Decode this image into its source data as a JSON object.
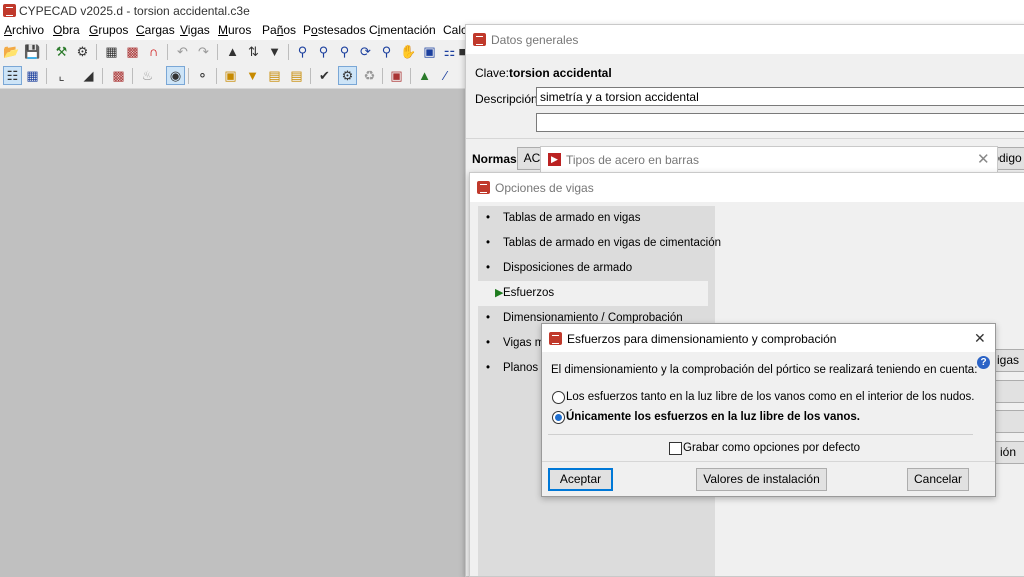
{
  "app": {
    "title": "CYPECAD v2025.d - torsion accidental.c3e"
  },
  "menu": [
    {
      "label": "Archivo",
      "u": "A"
    },
    {
      "label": "Obra",
      "u": "O"
    },
    {
      "label": "Grupos",
      "u": "G"
    },
    {
      "label": "Cargas",
      "u": "C"
    },
    {
      "label": "Vigas",
      "u": "V"
    },
    {
      "label": "Muros",
      "u": "M"
    },
    {
      "label": "Paños",
      "u": "ñ"
    },
    {
      "label": "Postesados",
      "u": "o"
    },
    {
      "label": "Cimentación",
      "u": "i"
    },
    {
      "label": "Calc",
      "u": ""
    }
  ],
  "datos_generales": {
    "title": "Datos generales",
    "clave_label": "Clave:",
    "clave_value": "torsion accidental",
    "descripcion_label": "Descripción:",
    "descripcion_value": "simetría y a torsion accidental",
    "descripcion_value2": "",
    "normas_label": "Normas:",
    "normas_btn": "AC",
    "codigo_btn": "ódigo"
  },
  "tipos_acero": {
    "title": "Tipos de acero en barras"
  },
  "opciones_vigas": {
    "title": "Opciones de vigas",
    "items": [
      {
        "label": "Tablas de armado en vigas"
      },
      {
        "label": "Tablas de armado en vigas de cimentación"
      },
      {
        "label": "Disposiciones de armado"
      },
      {
        "label": "Esfuerzos"
      },
      {
        "label": "Dimensionamiento / Comprobación"
      },
      {
        "label": "Vigas m"
      },
      {
        "label": "Planos"
      }
    ],
    "right_btn_1": "igas",
    "right_btn_4": "ión"
  },
  "esfuerzos_dialog": {
    "title": "Esfuerzos para dimensionamiento y comprobación",
    "description": "El dimensionamiento y la comprobación del pórtico se realizará teniendo en cuenta:",
    "option1": "Los esfuerzos tanto en la luz libre de los vanos como en el interior de los nudos.",
    "option2": "Únicamente los esfuerzos en la luz libre de los vanos.",
    "selected": 2,
    "checkbox_label": "Grabar como opciones por defecto",
    "accept": "Aceptar",
    "defaults": "Valores de instalación",
    "cancel": "Cancelar",
    "help": "?"
  }
}
